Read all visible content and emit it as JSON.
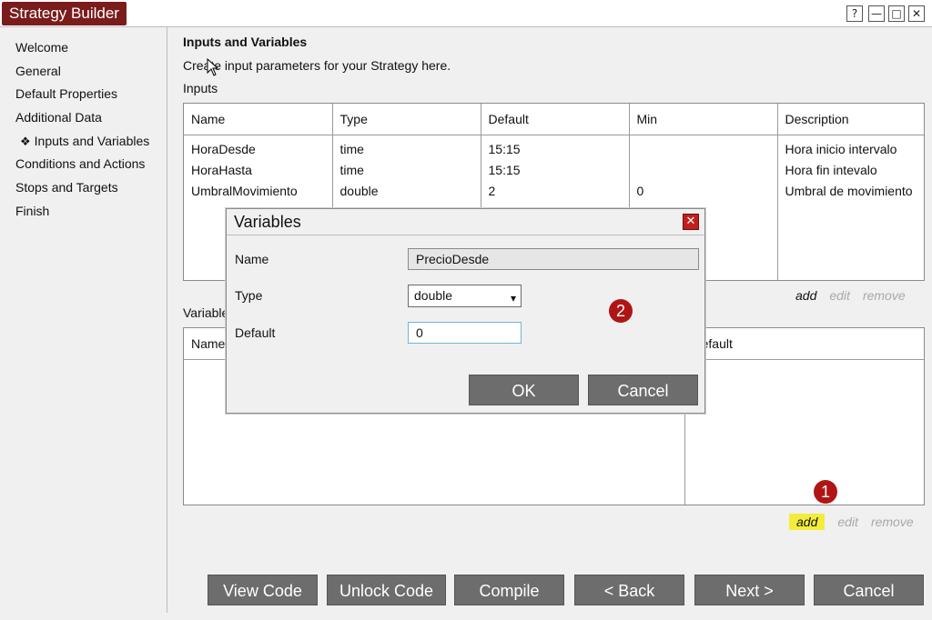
{
  "window": {
    "title": "Strategy Builder",
    "controls": {
      "help": "?",
      "minimize": "—",
      "maximize": "□",
      "close": "✕"
    }
  },
  "sidebar": {
    "items": [
      {
        "label": "Welcome"
      },
      {
        "label": "General"
      },
      {
        "label": "Default Properties"
      },
      {
        "label": "Additional Data"
      },
      {
        "label": "Inputs and Variables",
        "bullet": "❖",
        "current": true
      },
      {
        "label": "Conditions and Actions"
      },
      {
        "label": "Stops and Targets"
      },
      {
        "label": "Finish"
      }
    ]
  },
  "page": {
    "title": "Inputs and Variables",
    "description": "Create input parameters for your Strategy here.",
    "inputs_label": "Inputs",
    "variables_label": "Variables"
  },
  "inputs_table": {
    "headers": [
      "Name",
      "Type",
      "Default",
      "Min",
      "Description"
    ],
    "rows": [
      [
        "HoraDesde",
        "time",
        "15:15",
        "",
        "Hora inicio intervalo"
      ],
      [
        "HoraHasta",
        "time",
        "15:15",
        "",
        "Hora fin intevalo"
      ],
      [
        "UmbralMovimiento",
        "double",
        "2",
        "0",
        "Umbral de movimiento"
      ]
    ]
  },
  "variables_table": {
    "headers": [
      "Name",
      "Default"
    ]
  },
  "inputs_actions": {
    "add": "add",
    "edit": "edit",
    "remove": "remove"
  },
  "variables_actions": {
    "add": "add",
    "edit": "edit",
    "remove": "remove"
  },
  "markers": {
    "one": "1",
    "two": "2"
  },
  "dialog": {
    "title": "Variables",
    "close": "✕",
    "name_label": "Name",
    "name_value": "PrecioDesde",
    "type_label": "Type",
    "type_value": "double",
    "default_label": "Default",
    "default_value": "0",
    "ok": "OK",
    "cancel": "Cancel"
  },
  "footer": {
    "view_code": "View Code",
    "unlock_code": "Unlock Code",
    "compile": "Compile",
    "back": "< Back",
    "next": "Next >",
    "cancel": "Cancel"
  },
  "colors": {
    "title_bg": "#7a1c1c",
    "marker": "#b01515",
    "highlight": "#f3ec3a",
    "button_bg": "#6d6d6d"
  }
}
